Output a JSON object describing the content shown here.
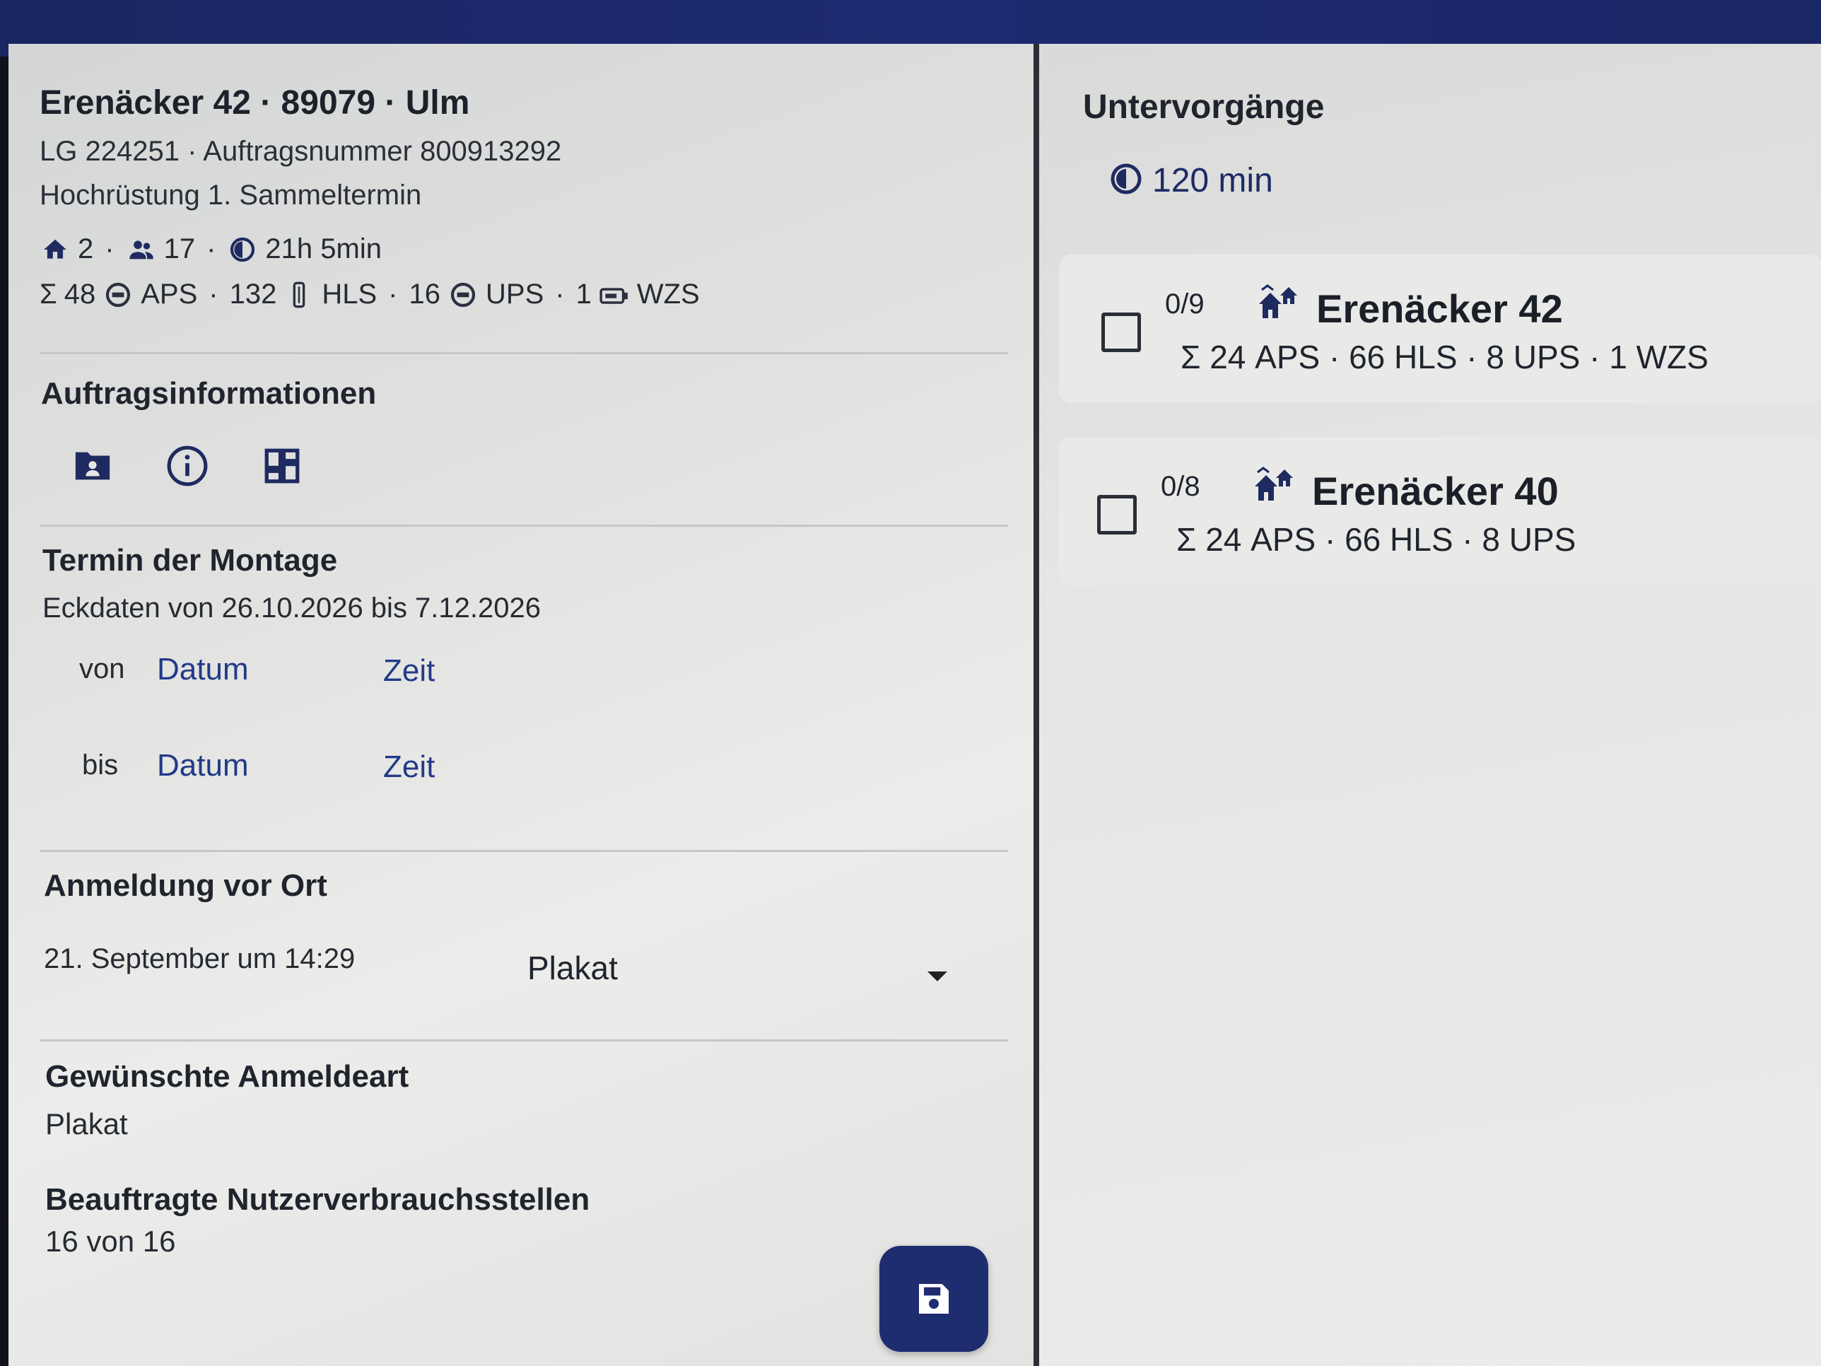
{
  "header": {
    "address": "Erenäcker 42 · 89079 · Ulm",
    "line2": "LG 224251 · Auftragsnummer 800913292",
    "line3": "Hochrüstung 1. Sammeltermin"
  },
  "stats1": {
    "houses": "2",
    "persons": "17",
    "duration": "21h 5min"
  },
  "stats2": {
    "sigma": "Σ",
    "aps_count": "48",
    "aps_label": "APS",
    "hls_count": "132",
    "hls_label": "HLS",
    "ups_count": "16",
    "ups_label": "UPS",
    "wzs_count": "1",
    "wzs_label": "WZS"
  },
  "auftragsinfo": {
    "title": "Auftragsinformationen",
    "icons": [
      "contact-card-icon",
      "info-icon",
      "grid-icon"
    ]
  },
  "termin": {
    "title": "Termin der Montage",
    "eckdaten": "Eckdaten von 26.10.2026 bis 7.12.2026",
    "von_label": "von",
    "bis_label": "bis",
    "date_placeholder": "Datum",
    "time_placeholder": "Zeit"
  },
  "anmeldung": {
    "title": "Anmeldung vor Ort",
    "date": "21. September um 14:29",
    "selected": "Plakat"
  },
  "gewuenscht": {
    "title": "Gewünschte Anmeldeart",
    "value": "Plakat"
  },
  "beauftragte": {
    "title": "Beauftragte Nutzerverbrauchsstellen",
    "value": "16 von 16"
  },
  "untervorgaenge": {
    "title": "Untervorgänge",
    "duration": "120 min",
    "items": [
      {
        "progress": "0/9",
        "name": "Erenäcker 42",
        "summary": "Σ  24 APS · 66 HLS · 8 UPS · 1 WZS",
        "checked": false
      },
      {
        "progress": "0/8",
        "name": "Erenäcker 40",
        "summary": "Σ  24 APS · 66 HLS · 8 UPS",
        "checked": false
      }
    ]
  },
  "colors": {
    "topbar": "#1d2b72",
    "accent": "#1e2d70",
    "link": "#223a88"
  }
}
